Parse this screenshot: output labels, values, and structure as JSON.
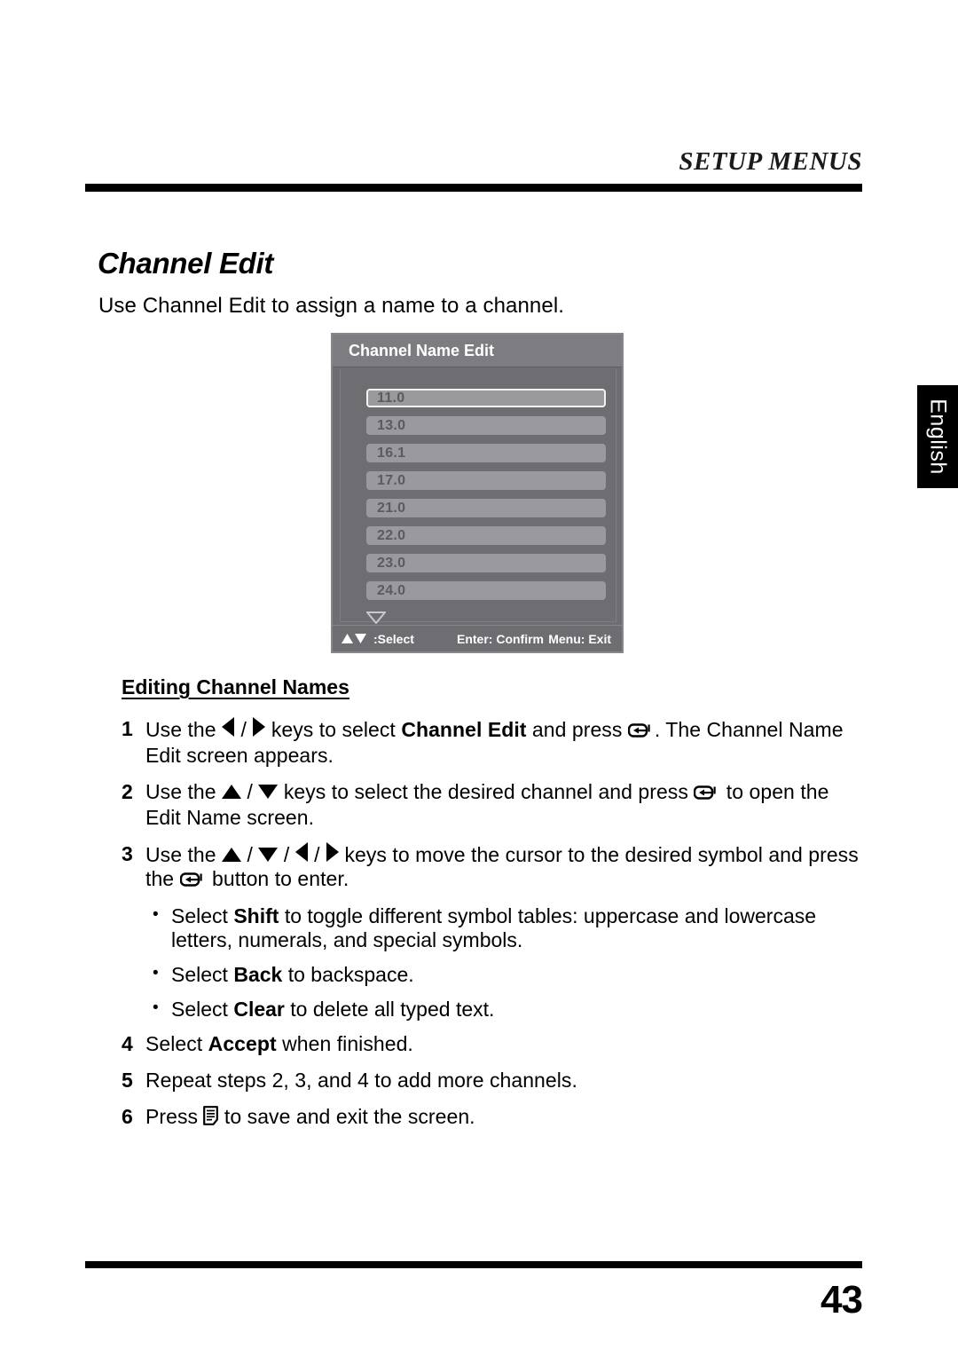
{
  "header": {
    "section_title": "SETUP MENUS"
  },
  "side_tab": {
    "language": "English"
  },
  "page": {
    "title": "Channel Edit",
    "intro": "Use Channel Edit to assign a name to a channel.",
    "number": "43"
  },
  "osd": {
    "title": "Channel Name Edit",
    "channels": [
      {
        "label": "11.0",
        "selected": true
      },
      {
        "label": "13.0",
        "selected": false
      },
      {
        "label": "16.1",
        "selected": false
      },
      {
        "label": "17.0",
        "selected": false
      },
      {
        "label": "21.0",
        "selected": false
      },
      {
        "label": "22.0",
        "selected": false
      },
      {
        "label": "23.0",
        "selected": false
      },
      {
        "label": "24.0",
        "selected": false
      }
    ],
    "scroll_indicator": "down-triangle-icon",
    "footer": {
      "select": ":Select",
      "confirm": "Enter: Confirm",
      "exit": "Menu: Exit"
    }
  },
  "instructions": {
    "subhead": "Editing Channel Names",
    "steps": [
      {
        "num": "1",
        "parts": [
          {
            "t": "text",
            "v": "Use the "
          },
          {
            "t": "icon",
            "v": "left-triangle-icon"
          },
          {
            "t": "text",
            "v": " / "
          },
          {
            "t": "icon",
            "v": "right-triangle-icon"
          },
          {
            "t": "text",
            "v": " keys to select "
          },
          {
            "t": "bold",
            "v": "Channel Edit"
          },
          {
            "t": "text",
            "v": " and press "
          },
          {
            "t": "icon",
            "v": "enter-key-icon"
          },
          {
            "t": "text",
            "v": ". The Channel Name Edit screen appears."
          }
        ]
      },
      {
        "num": "2",
        "parts": [
          {
            "t": "text",
            "v": "Use the "
          },
          {
            "t": "icon",
            "v": "up-triangle-icon"
          },
          {
            "t": "text",
            "v": " / "
          },
          {
            "t": "icon",
            "v": "down-triangle-icon"
          },
          {
            "t": "text",
            "v": " keys to select the desired channel and press "
          },
          {
            "t": "icon",
            "v": "enter-key-icon"
          },
          {
            "t": "text",
            "v": " to open the Edit Name screen."
          }
        ]
      },
      {
        "num": "3",
        "parts": [
          {
            "t": "text",
            "v": "Use the "
          },
          {
            "t": "icon",
            "v": "up-triangle-icon"
          },
          {
            "t": "text",
            "v": " / "
          },
          {
            "t": "icon",
            "v": "down-triangle-icon"
          },
          {
            "t": "text",
            "v": " / "
          },
          {
            "t": "icon",
            "v": "left-triangle-icon"
          },
          {
            "t": "text",
            "v": " / "
          },
          {
            "t": "icon",
            "v": "right-triangle-icon"
          },
          {
            "t": "text",
            "v": " keys to move the cursor to the desired symbol and press the "
          },
          {
            "t": "icon",
            "v": "enter-key-icon"
          },
          {
            "t": "text",
            "v": " button to enter."
          }
        ]
      },
      {
        "num": "4",
        "parts": [
          {
            "t": "text",
            "v": "Select "
          },
          {
            "t": "bold",
            "v": "Accept"
          },
          {
            "t": "text",
            "v": " when finished."
          }
        ]
      },
      {
        "num": "5",
        "parts": [
          {
            "t": "text",
            "v": "Repeat steps 2, 3, and 4 to add more channels."
          }
        ]
      },
      {
        "num": "6",
        "parts": [
          {
            "t": "text",
            "v": "Press "
          },
          {
            "t": "icon",
            "v": "menu-key-icon"
          },
          {
            "t": "text",
            "v": " to save and exit the screen."
          }
        ]
      }
    ],
    "bullets": [
      {
        "after_step": "3",
        "parts": [
          {
            "t": "text",
            "v": "Select "
          },
          {
            "t": "bold",
            "v": "Shift"
          },
          {
            "t": "text",
            "v": " to toggle different symbol tables: uppercase and lowercase letters, numerals, and special symbols."
          }
        ]
      },
      {
        "after_step": "3",
        "parts": [
          {
            "t": "text",
            "v": "Select "
          },
          {
            "t": "bold",
            "v": "Back"
          },
          {
            "t": "text",
            "v": " to backspace."
          }
        ]
      },
      {
        "after_step": "3",
        "parts": [
          {
            "t": "text",
            "v": "Select "
          },
          {
            "t": "bold",
            "v": "Clear"
          },
          {
            "t": "text",
            "v": " to delete all typed text."
          }
        ]
      }
    ]
  },
  "colors": {
    "rule": "#000000",
    "osd_panel": "#6d6d72",
    "osd_title_bar": "#7c7c81",
    "osd_row": "#9a9a9e",
    "osd_row_text": "#5a5a60",
    "tab_background": "#000000",
    "tab_text": "#ffffff"
  }
}
